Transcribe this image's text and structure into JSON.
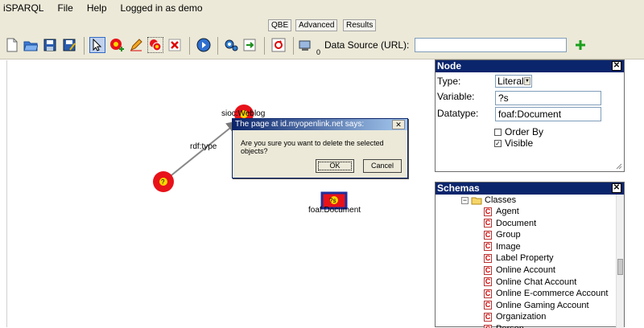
{
  "menu": {
    "app": "iSPARQL",
    "file": "File",
    "help": "Help",
    "login_status": "Logged in as demo"
  },
  "tabs": [
    "QBE",
    "Advanced",
    "Results"
  ],
  "toolbar": {
    "datasource_label": "Data Source (URL):",
    "datasource_value": "",
    "counter": "0"
  },
  "graph": {
    "nodes": [
      {
        "label": "sioc:Weblog",
        "text": "?"
      },
      {
        "label": "",
        "text": "?"
      },
      {
        "label": "foaf:Document",
        "text": "?s"
      }
    ],
    "edge_label": "rdf:type"
  },
  "dialog": {
    "title": "The page at id.myopenlink.net says:",
    "message": "Are you sure you want to delete the selected objects?",
    "ok": "OK",
    "cancel": "Cancel"
  },
  "node_panel": {
    "title": "Node",
    "type_label": "Type:",
    "type_value": "Literal",
    "variable_label": "Variable:",
    "variable_value": "?s",
    "datatype_label": "Datatype:",
    "datatype_value": "foaf:Document",
    "order_by": "Order By",
    "order_by_checked": false,
    "visible": "Visible",
    "visible_checked": true
  },
  "schemas_panel": {
    "title": "Schemas",
    "group": "Classes",
    "classes": [
      "Agent",
      "Document",
      "Group",
      "Image",
      "Label Property",
      "Online Account",
      "Online Chat Account",
      "Online E-commerce Account",
      "Online Gaming Account",
      "Organization",
      "Person"
    ]
  },
  "colors": {
    "panel_title": "#0b256c",
    "node_red": "#e8121a",
    "node_selected_border": "#1f2f9e",
    "toolbar_bg": "#ece9d8"
  }
}
